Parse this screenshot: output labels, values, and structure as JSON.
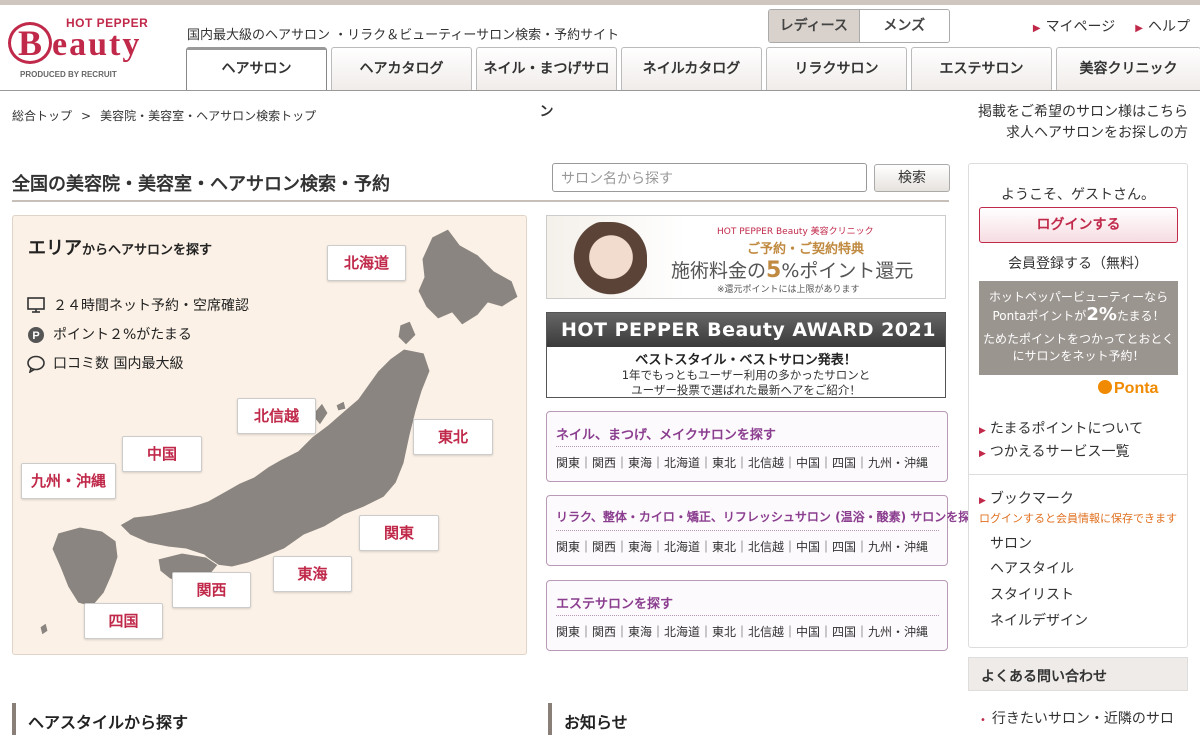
{
  "header": {
    "logo_top": "HOT PEPPER",
    "logo_b": "B",
    "logo_rest": "eauty",
    "logo_produced": "PRODUCED BY RECRUIT",
    "tagline": "国内最大級のヘアサロン ・リラク＆ビューティーサロン検索・予約サイト",
    "gender": [
      "レディース",
      "メンズ"
    ],
    "links": [
      "マイページ",
      "ヘルプ"
    ]
  },
  "tabs": [
    "ヘアサロン",
    "ヘアカタログ",
    "ネイル・まつげサロン",
    "ネイルカタログ",
    "リラクサロン",
    "エステサロン",
    "美容クリニック"
  ],
  "breadcrumb": {
    "home": "総合トップ",
    "sep": ">",
    "current": "美容院・美容室・ヘアサロン検索トップ"
  },
  "right_links": [
    "掲載をご希望のサロン様はこちら",
    "求人ヘアサロンをお探しの方"
  ],
  "title": "全国の美容院・美容室・ヘアサロン検索・予約",
  "search": {
    "placeholder": "サロン名から探す",
    "button": "検索"
  },
  "area": {
    "heading_big": "エリア",
    "heading_small": "からヘアサロンを探す",
    "features": [
      "２４時間ネット予約・空席確認",
      "ポイント２%がたまる",
      "口コミ数 国内最大級"
    ],
    "regions": [
      "北海道",
      "東北",
      "北信越",
      "中国",
      "九州・沖縄",
      "関東",
      "東海",
      "関西",
      "四国"
    ]
  },
  "banner_clinic": {
    "brand": "HOT PEPPER Beauty 美容クリニック",
    "sub": "ご予約・ご契約特典",
    "main_pre": "施術料金の",
    "main_num": "5",
    "main_post": "%ポイント還元",
    "note": "※還元ポイントには上限があります"
  },
  "banner_award": {
    "title": "HOT PEPPER Beauty AWARD 2021",
    "sub": "ベストスタイル・ベストサロン発表！",
    "line1": "1年でもっともユーザー利用の多かったサロンと",
    "line2": "ユーザー投票で選ばれた最新ヘアをご紹介！"
  },
  "category_boxes": [
    {
      "title": "ネイル、まつげ、メイクサロンを探す",
      "regions": "関東｜関西｜東海｜北海道｜東北｜北信越｜中国｜四国｜九州・沖縄"
    },
    {
      "title": "リラク、整体・カイロ・矯正、リフレッシュサロン (温浴・酸素) サロンを探す",
      "regions": "関東｜関西｜東海｜北海道｜東北｜北信越｜中国｜四国｜九州・沖縄"
    },
    {
      "title": "エステサロンを探す",
      "regions": "関東｜関西｜東海｜北海道｜東北｜北信越｜中国｜四国｜九州・沖縄"
    }
  ],
  "sidebar": {
    "welcome": "ようこそ、ゲストさん。",
    "login": "ログインする",
    "register": "会員登録する（無料）",
    "ponta_line1": "ホットペッパービューティーなら",
    "ponta_line2_pre": "Pontaポイントが",
    "ponta_line2_num": "2%",
    "ponta_line2_post": "たまる！",
    "ponta_line3": "ためたポイントをつかってとおとく",
    "ponta_line4": "にサロンをネット予約！",
    "ponta_logo": "Ponta",
    "point_links": [
      "たまるポイントについて",
      "つかえるサービス一覧"
    ],
    "bookmark_title": "ブックマーク",
    "bookmark_note": "ログインすると会員情報に保存できます",
    "bookmark_items": [
      "サロン",
      "ヘアスタイル",
      "スタイリスト",
      "ネイルデザイン"
    ],
    "faq_title": "よくある問い合わせ",
    "faq_item": "行きたいサロン・近隣のサロ"
  },
  "sections": [
    "ヘアスタイルから探す",
    "お知らせ"
  ]
}
